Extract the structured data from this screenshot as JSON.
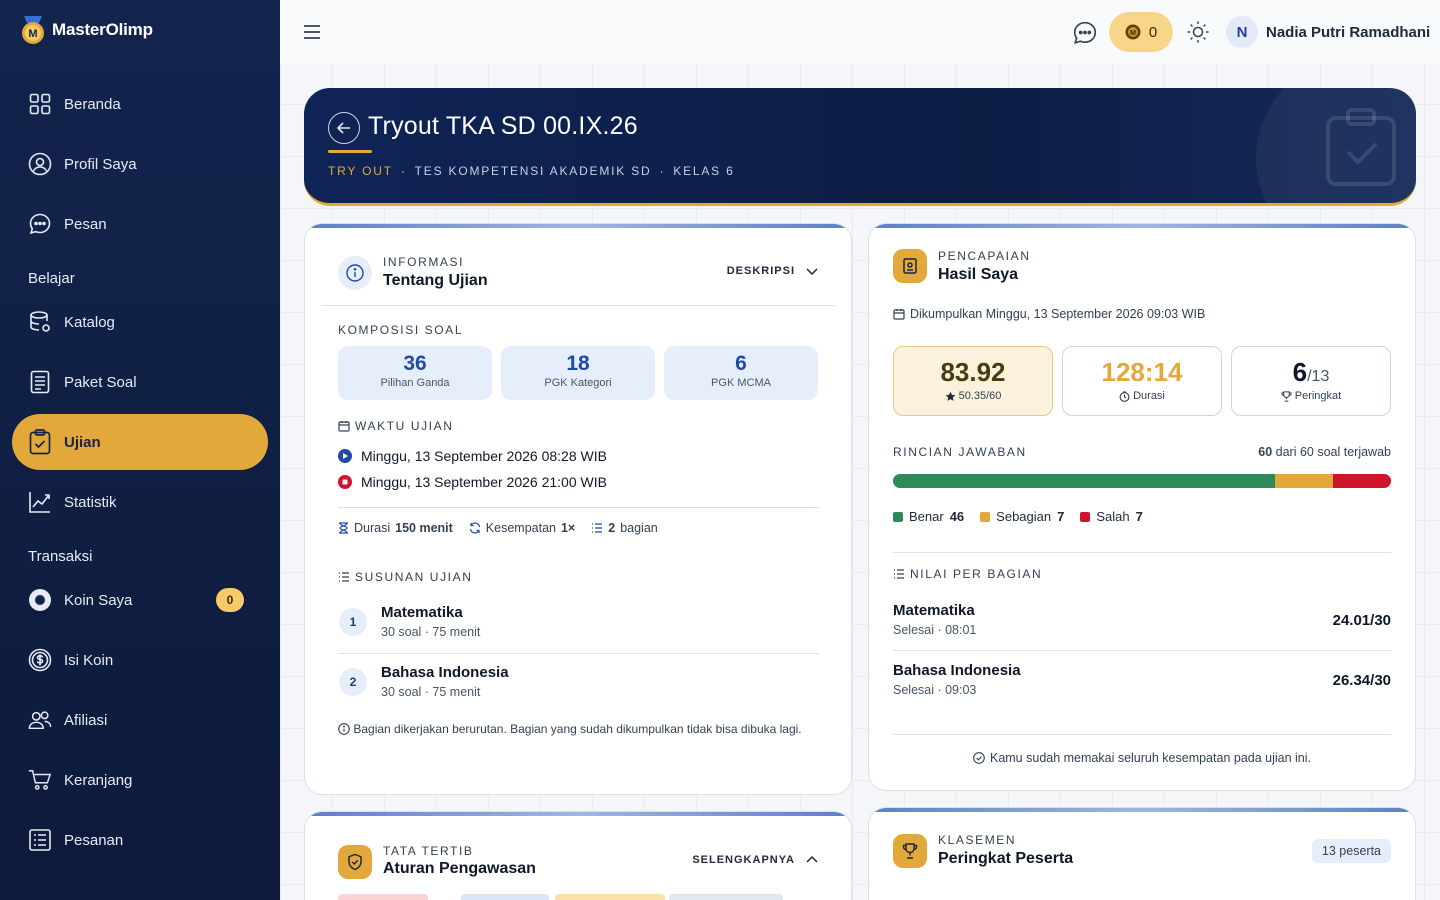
{
  "app": {
    "name": "MasterOlimp"
  },
  "sidebar": {
    "items": [
      {
        "label": "Beranda",
        "icon": "grid-icon"
      },
      {
        "label": "Profil Saya",
        "icon": "user-circle-icon"
      },
      {
        "label": "Pesan",
        "icon": "chat-icon"
      },
      {
        "label": "Katalog",
        "icon": "database-icon"
      },
      {
        "label": "Paket Soal",
        "icon": "document-icon"
      },
      {
        "label": "Ujian",
        "icon": "clipboard-check-icon"
      },
      {
        "label": "Statistik",
        "icon": "chart-line-icon"
      },
      {
        "label": "Koin Saya",
        "icon": "coin-icon",
        "badge": "0"
      },
      {
        "label": "Isi Koin",
        "icon": "dollar-circle-icon"
      },
      {
        "label": "Afiliasi",
        "icon": "users-icon"
      },
      {
        "label": "Keranjang",
        "icon": "cart-icon"
      },
      {
        "label": "Pesanan",
        "icon": "list-icon"
      }
    ],
    "sections": {
      "belajar": "Belajar",
      "transaksi": "Transaksi"
    }
  },
  "topbar": {
    "coin_count": "0",
    "user_initial": "N",
    "user_name": "Nadia Putri Ramadhani"
  },
  "hero": {
    "title": "Tryout TKA SD 00.IX.26",
    "tag1": "TRY OUT",
    "tag2": "TES KOMPETENSI AKADEMIK SD",
    "tag3": "KELAS 6",
    "sep": "·"
  },
  "info_card": {
    "kicker": "INFORMASI",
    "title": "Tentang Ujian",
    "toggle_label": "DESKRIPSI",
    "composition_heading": "KOMPOSISI SOAL",
    "composition": [
      {
        "count": "36",
        "label": "Pilihan Ganda"
      },
      {
        "count": "18",
        "label": "PGK Kategori"
      },
      {
        "count": "6",
        "label": "PGK MCMA"
      }
    ],
    "time_heading": "WAKTU UJIAN",
    "start": "Minggu, 13 September 2026 08:28 WIB",
    "end": "Minggu, 13 September 2026 21:00 WIB",
    "duration_label": "Durasi",
    "duration_value": "150 menit",
    "attempts_label": "Kesempatan",
    "attempts_value": "1×",
    "parts_value": "2",
    "parts_label": "bagian",
    "structure_heading": "SUSUNAN UJIAN",
    "sections": [
      {
        "num": "1",
        "name": "Matematika",
        "meta": "30 soal · 75 menit"
      },
      {
        "num": "2",
        "name": "Bahasa Indonesia",
        "meta": "30 soal · 75 menit"
      }
    ],
    "note": "Bagian dikerjakan berurutan. Bagian yang sudah dikumpulkan tidak bisa dibuka lagi."
  },
  "result_card": {
    "kicker": "PENCAPAIAN",
    "title": "Hasil Saya",
    "submitted": "Dikumpulkan Minggu, 13 September 2026 09:03 WIB",
    "score": "83.92",
    "score_sub": "50.35/60",
    "duration": "128:14",
    "duration_label": "Durasi",
    "rank": "6",
    "rank_total": "/13",
    "rank_label": "Peringkat",
    "breakdown_heading": "RINCIAN JAWABAN",
    "answered_count": "60",
    "answered_text": "dari 60 soal terjawab",
    "correct_label": "Benar",
    "correct": 46,
    "partial_label": "Sebagian",
    "partial": 7,
    "wrong_label": "Salah",
    "wrong": 7,
    "total": 60,
    "colors": {
      "correct": "#2f8a5a",
      "partial": "#e2a83a",
      "wrong": "#d0142c"
    },
    "per_part_heading": "NILAI PER BAGIAN",
    "parts": [
      {
        "name": "Matematika",
        "meta": "Selesai · 08:01",
        "score": "24.01/30"
      },
      {
        "name": "Bahasa Indonesia",
        "meta": "Selesai · 09:03",
        "score": "26.34/30"
      }
    ],
    "footer_note": "Kamu sudah memakai seluruh kesempatan pada ujian ini."
  },
  "rules_card": {
    "kicker": "TATA TERTIB",
    "title": "Aturan Pengawasan",
    "toggle_label": "SELENGKAPNYA"
  },
  "leaderboard_card": {
    "kicker": "KLASEMEN",
    "title": "Peringkat Peserta",
    "count_badge": "13 peserta"
  }
}
